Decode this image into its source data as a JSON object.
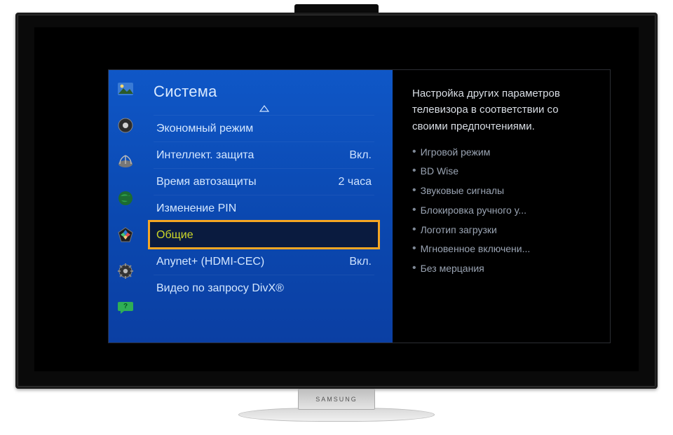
{
  "brand": "SAMSUNG",
  "menu": {
    "title": "Система",
    "items": [
      {
        "label": "Экономный режим",
        "value": ""
      },
      {
        "label": "Интеллект. защита",
        "value": "Вкл."
      },
      {
        "label": "Время автозащиты",
        "value": "2 часа"
      },
      {
        "label": "Изменение PIN",
        "value": ""
      },
      {
        "label": "Общие",
        "value": ""
      },
      {
        "label": "Anynet+ (HDMI-CEC)",
        "value": "Вкл."
      },
      {
        "label": "Видео по запросу DivX®",
        "value": ""
      }
    ],
    "selected_index": 4
  },
  "help": {
    "description": "Настройка других параметров телевизора в соответствии со своими предпочтениями.",
    "bullets": [
      "Игровой режим",
      "BD Wise",
      "Звуковые сигналы",
      "Блокировка ручного у...",
      "Логотип загрузки",
      "Мгновенное включени...",
      "Без мерцания"
    ]
  },
  "rail_icons": [
    "picture-icon",
    "sound-icon",
    "network-icon",
    "globe-icon",
    "smarthub-icon",
    "settings-icon",
    "support-icon"
  ]
}
